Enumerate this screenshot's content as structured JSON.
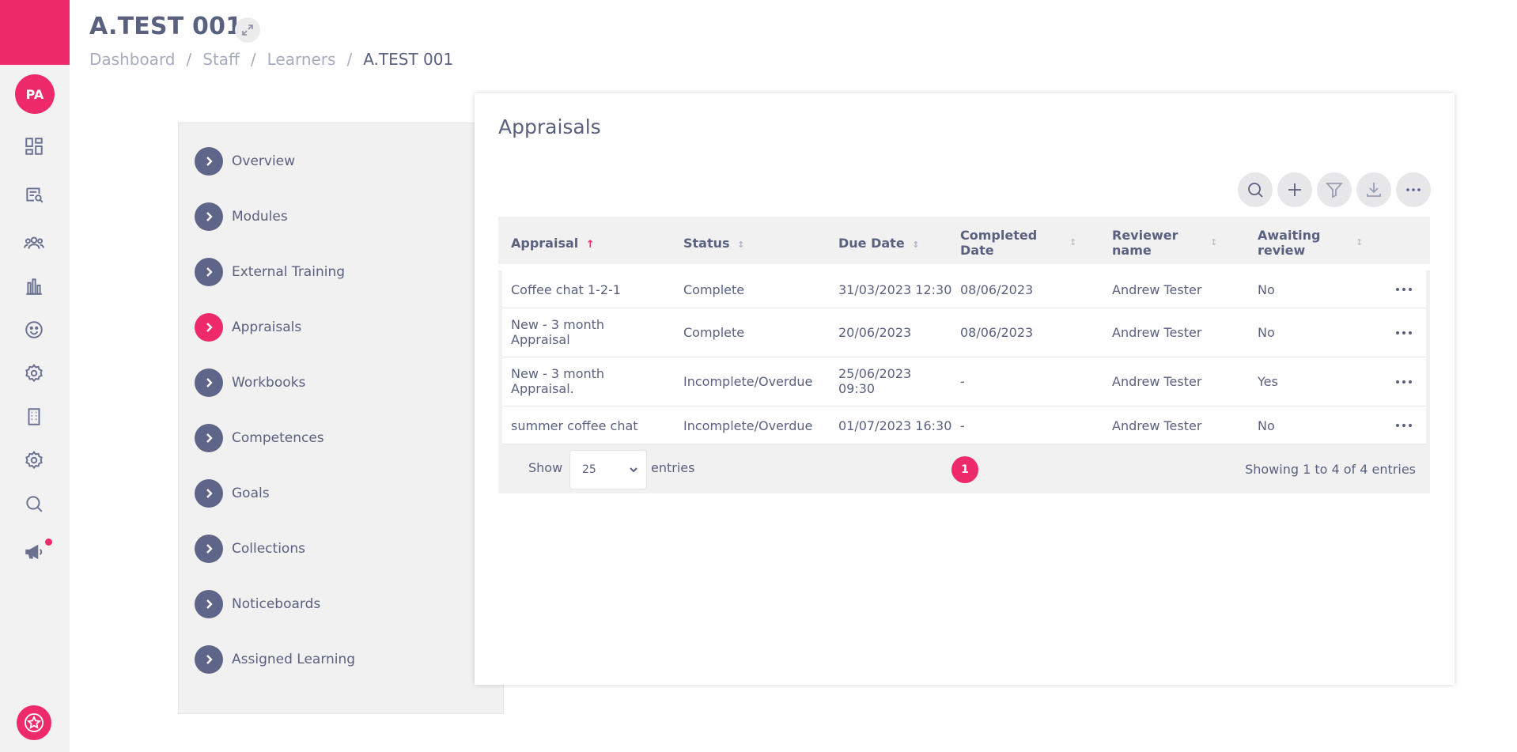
{
  "page": {
    "title": "A.TEST 001",
    "breadcrumb": [
      "Dashboard",
      "Staff",
      "Learners",
      "A.TEST 001"
    ]
  },
  "rail": {
    "avatar_initials": "PA",
    "icons": [
      "dashboard-icon",
      "search-document-icon",
      "users-icon",
      "bar-chart-icon",
      "smiley-icon",
      "settings-icon",
      "building-icon",
      "settings-icon",
      "search-icon",
      "megaphone-icon"
    ],
    "accent_color": "#ef2a6b"
  },
  "nav": {
    "items": [
      {
        "label": "Overview",
        "active": false
      },
      {
        "label": "Modules",
        "active": false
      },
      {
        "label": "External Training",
        "active": false
      },
      {
        "label": "Appraisals",
        "active": true
      },
      {
        "label": "Workbooks",
        "active": false
      },
      {
        "label": "Competences",
        "active": false
      },
      {
        "label": "Goals",
        "active": false
      },
      {
        "label": "Collections",
        "active": false
      },
      {
        "label": "Noticeboards",
        "active": false
      },
      {
        "label": "Assigned Learning",
        "active": false
      }
    ]
  },
  "card": {
    "title": "Appraisals",
    "toolbar": [
      "search-icon",
      "plus-icon",
      "filter-icon",
      "download-icon",
      "more-icon"
    ]
  },
  "table": {
    "columns": [
      {
        "label": "Appraisal",
        "sort": "asc"
      },
      {
        "label": "Status",
        "sort": "none"
      },
      {
        "label": "Due Date",
        "sort": "none"
      },
      {
        "label": "Completed Date",
        "sort": "none"
      },
      {
        "label": "Reviewer name",
        "sort": "none"
      },
      {
        "label": "Awaiting review",
        "sort": "none"
      }
    ],
    "rows": [
      [
        "Coffee chat 1-2-1",
        "Complete",
        "31/03/2023 12:30",
        "08/06/2023",
        "Andrew Tester",
        "No"
      ],
      [
        "New - 3 month Appraisal",
        "Complete",
        "20/06/2023",
        "08/06/2023",
        "Andrew Tester",
        "No"
      ],
      [
        "New - 3 month Appraisal.",
        "Incomplete/Overdue",
        "25/06/2023 09:30",
        "-",
        "Andrew Tester",
        "Yes"
      ],
      [
        "summer coffee chat",
        "Incomplete/Overdue",
        "01/07/2023 16:30",
        "-",
        "Andrew Tester",
        "No"
      ]
    ],
    "footer": {
      "show_label": "Show",
      "page_size": "25",
      "entries_label": "entries",
      "current_page": "1",
      "showing_text": "Showing 1 to 4 of 4 entries"
    }
  }
}
